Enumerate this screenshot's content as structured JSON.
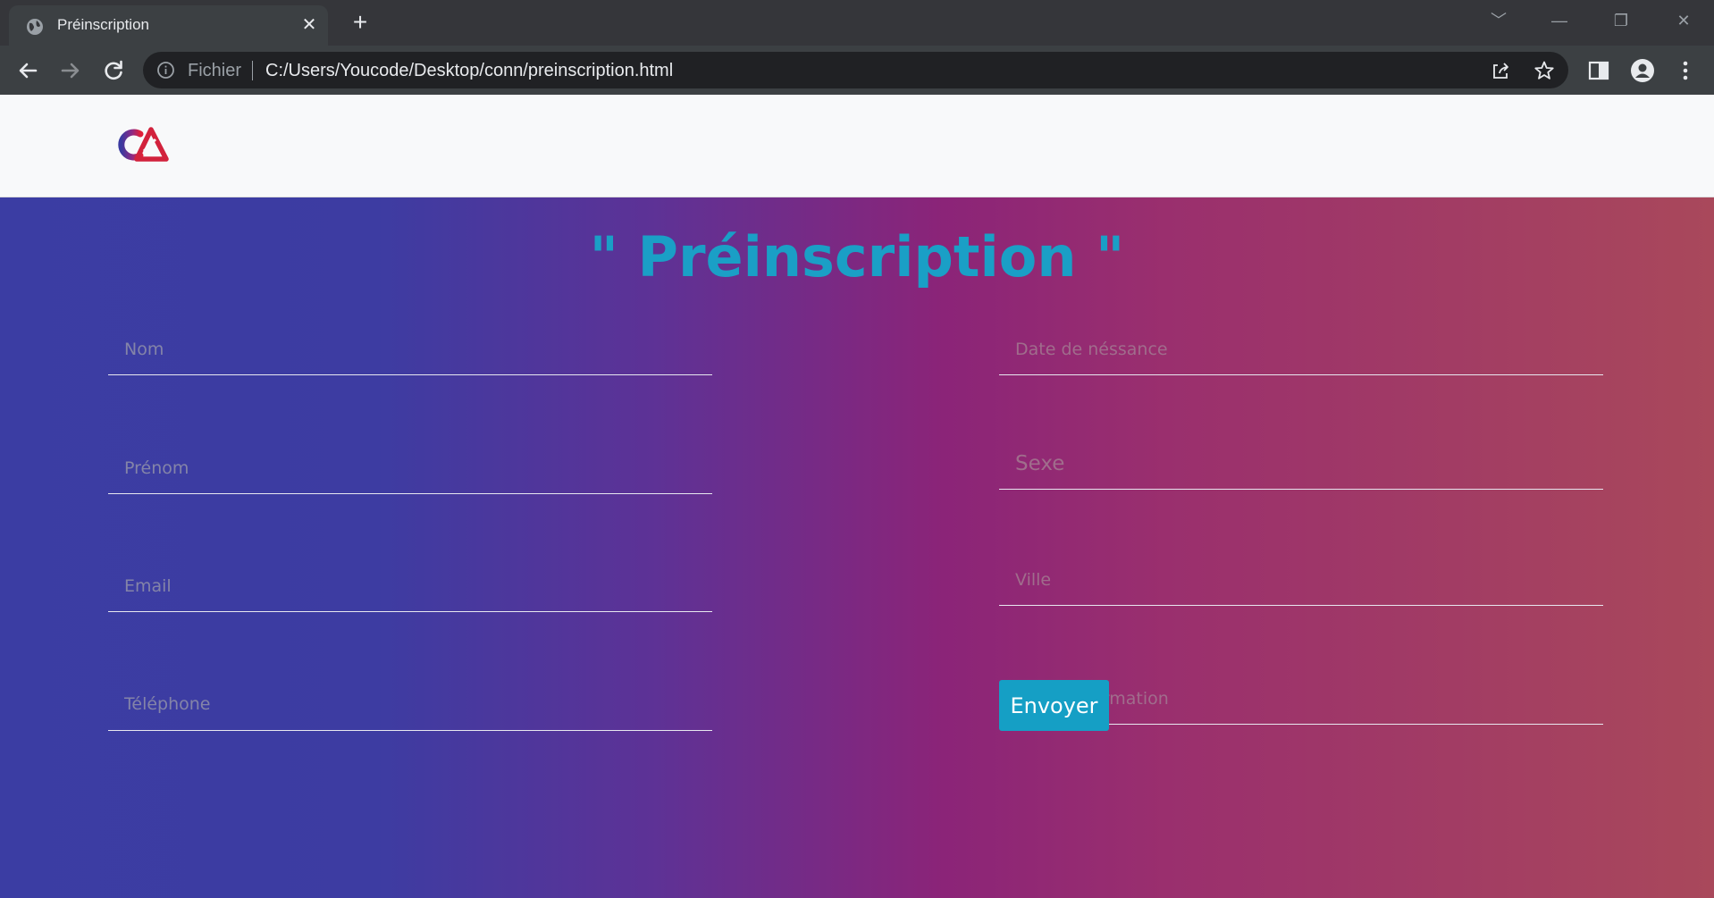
{
  "browser": {
    "tab_title": "Préinscription",
    "tab_close": "✕",
    "new_tab": "+",
    "url_scheme": "Fichier",
    "url": "C:/Users/Youcode/Desktop/conn/preinscription.html",
    "window_controls": [
      "﹀",
      "—",
      "❐",
      "✕"
    ]
  },
  "page": {
    "heading": "\" Préinscription \"",
    "left_fields": [
      {
        "placeholder": "Nom"
      },
      {
        "placeholder": "Prénom"
      },
      {
        "placeholder": "Email"
      },
      {
        "placeholder": "Téléphone"
      }
    ],
    "right_fields": [
      {
        "placeholder": "Date de néssance"
      },
      {
        "placeholder": "Sexe"
      },
      {
        "placeholder": "Ville"
      },
      {
        "placeholder": "Type de formation"
      }
    ],
    "submit_label": "Envoyer"
  },
  "colors": {
    "heading": "#1a9fc6",
    "button": "#159fc5",
    "gradient_start": "#3b3da3",
    "gradient_mid": "#8b2478",
    "gradient_end": "#a9485b"
  },
  "icons": [
    "globe-icon",
    "close-icon",
    "plus-icon",
    "back-icon",
    "forward-icon",
    "reload-icon",
    "info-icon",
    "share-icon",
    "star-icon",
    "sidepanel-icon",
    "profile-icon",
    "menu-icon"
  ]
}
